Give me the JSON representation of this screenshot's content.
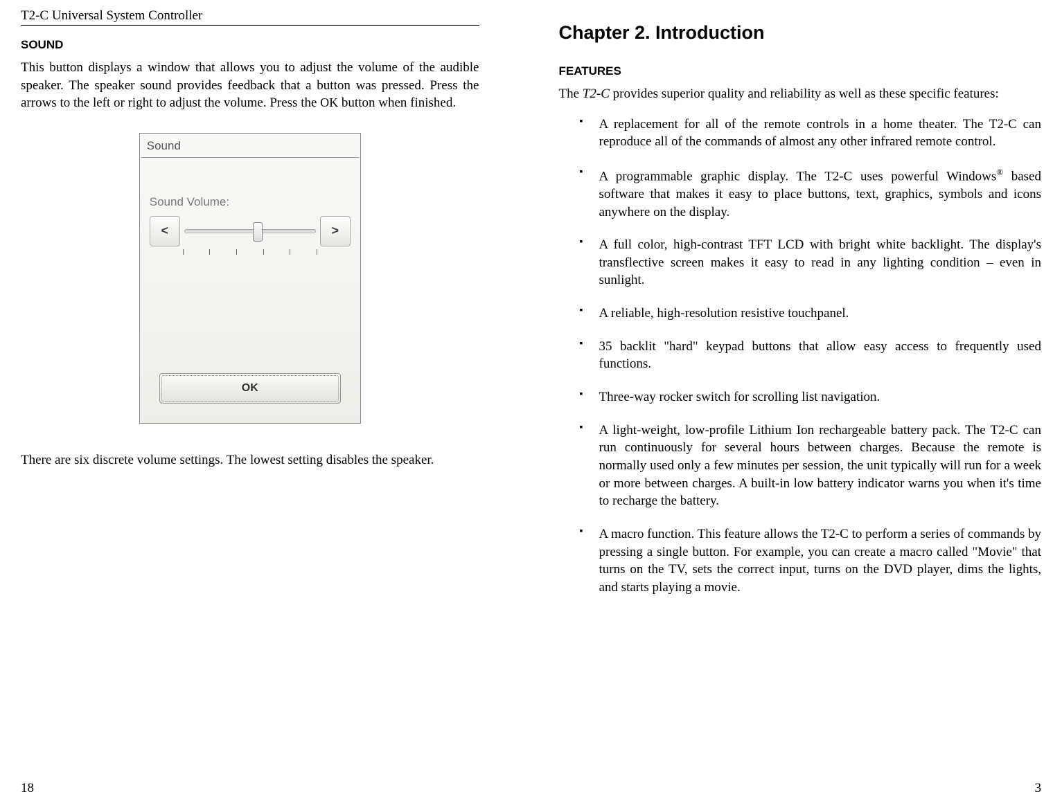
{
  "left_page": {
    "header": "T2-C Universal System Controller",
    "sound_heading": "SOUND",
    "sound_paragraph_before_ok": "This button displays a window that allows you to adjust the volume of the audible speaker. The speaker sound provides feedback that a button was pressed. Press the arrows to the left or right to adjust the volume. Press the ",
    "ok_smallcaps": "OK",
    "sound_paragraph_after_ok": " button when finished.",
    "dialog": {
      "title": "Sound",
      "volume_label": "Sound Volume:",
      "less_symbol": "<",
      "more_symbol": ">",
      "ok_label": "OK",
      "slider_value": 3,
      "slider_max": 6
    },
    "closing_paragraph": "There are six discrete volume settings. The lowest setting disables the speaker.",
    "page_number": "18"
  },
  "right_page": {
    "chapter_heading": "Chapter 2. Introduction",
    "features_heading": "FEATURES",
    "intro_before_italic": "The ",
    "intro_italic": "T2-C",
    "intro_after_italic": " provides superior quality and reliability as well as these specific features:",
    "features": [
      {
        "parts": [
          {
            "t": "A replacement for all of the remote controls in a home theater. The "
          },
          {
            "t": "T2-C",
            "it": true
          },
          {
            "t": " can reproduce all of the commands of almost any other infrared remote control."
          }
        ]
      },
      {
        "parts": [
          {
            "t": "A programmable graphic display. The "
          },
          {
            "t": "T2-C",
            "it": true
          },
          {
            "t": " uses powerful Windows"
          },
          {
            "t": "®",
            "sup": true
          },
          {
            "t": " based software that makes it easy to place buttons, text, graphics, symbols and icons anywhere on the display."
          }
        ]
      },
      {
        "parts": [
          {
            "t": "A full color, high-contrast TFT LCD with bright white backlight. The display's transflective screen makes it easy to read in any lighting condition – even in sunlight."
          }
        ]
      },
      {
        "parts": [
          {
            "t": " A reliable, high-resolution resistive touchpanel."
          }
        ]
      },
      {
        "parts": [
          {
            "t": "35 backlit \"hard\" keypad buttons that allow easy access to frequently used functions."
          }
        ]
      },
      {
        "parts": [
          {
            "t": "Three-way rocker switch for scrolling list navigation."
          }
        ]
      },
      {
        "parts": [
          {
            "t": "A light-weight, low-profile Lithium Ion rechargeable battery pack. The "
          },
          {
            "t": "T2-C",
            "it": true
          },
          {
            "t": " can run continuously for several hours between charges. Because the remote is normally used only a few minutes per session, the unit typically will run for a week or more between charges. A built-in low battery indicator warns you when it's time to recharge the battery."
          }
        ]
      },
      {
        "parts": [
          {
            "t": "A macro function. This feature allows the "
          },
          {
            "t": "T2-C",
            "it": true
          },
          {
            "t": " to perform a series of commands by pressing a single button. For example, you can create a macro called \"Movie\" that turns on the TV, sets the correct input, turns on the DVD player, dims the lights, and starts playing a movie."
          }
        ]
      }
    ],
    "page_number": "3"
  }
}
